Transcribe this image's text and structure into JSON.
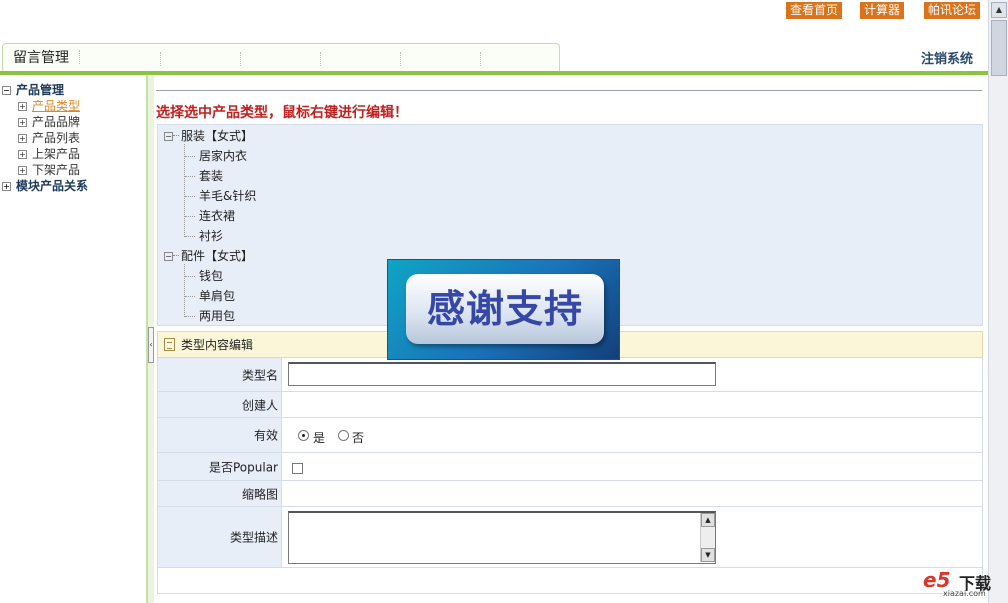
{
  "top_links": [
    "查看首页",
    "计算器",
    "帕讯论坛"
  ],
  "tabs": {
    "active": "留言管理"
  },
  "logout_label": "注销系统",
  "left_tree": {
    "root": "产品管理",
    "items": [
      "产品类型",
      "产品品牌",
      "产品列表",
      "上架产品",
      "下架产品"
    ],
    "active_item": "产品类型",
    "second_root": "模块产品关系"
  },
  "prompt": "选择选中产品类型，鼠标右键进行编辑！",
  "categories": [
    {
      "label": "服装【女式】",
      "children": [
        "居家内衣",
        "套装",
        "羊毛&针织",
        "连衣裙",
        "衬衫"
      ]
    },
    {
      "label": "配件【女式】",
      "children": [
        "钱包",
        "单肩包",
        "两用包"
      ]
    }
  ],
  "editor": {
    "header": "类型内容编辑",
    "fields": {
      "name_label": "类型名",
      "name_value": "",
      "creator_label": "创建人",
      "creator_value": "",
      "valid_label": "有效",
      "valid_yes": "是",
      "valid_no": "否",
      "valid_selected": "是",
      "popular_label": "是否Popular",
      "popular_checked": false,
      "thumb_label": "缩略图",
      "desc_label": "类型描述",
      "desc_value": ""
    }
  },
  "overlay": {
    "text": "感谢支持"
  },
  "watermark": {
    "logo": "e5",
    "text": "下载",
    "url": "xiazai.com"
  },
  "colors": {
    "accent_green": "#8ac43f",
    "prompt_red": "#c0201f",
    "top_link_bg": "#d9731c",
    "panel_blue": "#e7eef8",
    "active_orange": "#d88a2a"
  }
}
